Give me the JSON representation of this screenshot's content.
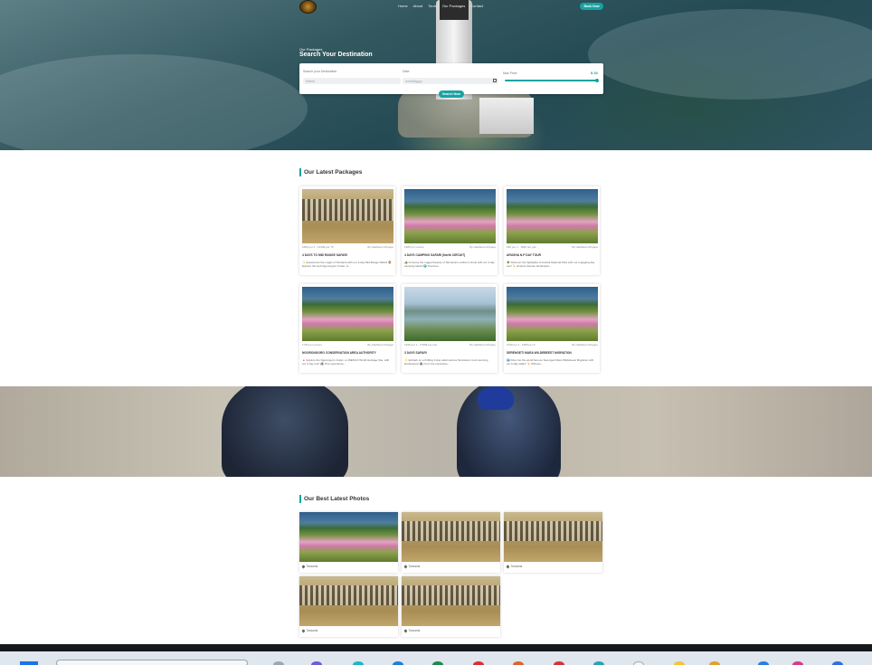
{
  "nav": {
    "items": [
      "Home",
      "About",
      "Tours",
      "Our Packages",
      "Contact"
    ],
    "book_now": "Book Now"
  },
  "search": {
    "eyebrow": "Our Packages",
    "title": "Search Your Destination",
    "destination_label": "Search your Destination",
    "destination_placeholder": "Select",
    "date_label": "Date",
    "date_placeholder": "mm/dd/yyyy",
    "price_label": "Max Price",
    "price_value": "$ 33",
    "price_level": 1.0,
    "button": "Search Now"
  },
  "packages": {
    "title": "Our Latest Packages",
    "items": [
      {
        "price": "1800 per 1 - 1640$ per 70",
        "author": "By Haidhuan Mnyape",
        "title": "4 DAYS TO MID RANGE SAFARI",
        "desc": "✨ Experience the magic of Tanzania with our 4-day Mid-Range Safari! 🦁 Explore the lush Ngorongoro Crater, w...",
        "image": "zebra"
      },
      {
        "price": "1980 per person",
        "author": "By Haidhuan Mnyape",
        "title": "4 DAYS CAMPING SAFARI (North CIRCUIT)",
        "desc": "🏕️ Immerse the rugged beauty of Tanzania's northern circuit with our 4-day camping safari! 🌍 Traverse...",
        "image": "flamingo"
      },
      {
        "price": "290 per 1 - 1890 per pax",
        "author": "By Haidhuan Mnyape",
        "title": "ARUSHA N.P DAY TOUR",
        "desc": "🌳 Discover the highlights of Arusha National Park with our engaging day tour! 🦒 Explore diverse landscapin...",
        "image": "flamingo"
      },
      {
        "price": "1700 per person",
        "author": "By Haidhuan Mnyape",
        "title": "NGORONGORO CONSERVATION AREA AUTHORITY",
        "desc": "🔺 Explore the Ngorongoro Crater, a UNESCO World Heritage Site, with our 2 day tour! 🦓 This experience...",
        "image": "flamingo"
      },
      {
        "price": "1290 per 1 - 1780$ per pax",
        "author": "By Haidhuan Mnyape",
        "title": "3 DAYS SAFARI",
        "desc": "✨ Embark on a thrilling 3-day safari across Tanzania's most stunning landscapes! 🦓 From the expansive...",
        "image": "lake"
      },
      {
        "price": "2790 per 1 - 1890 per 9",
        "author": "By Haidhuan Mnyape",
        "title": "SERENGETI MARA WILDEBEEST MIGRATION",
        "desc": "🌍 Dive into the world famous Serengeti Mara Wildebeest Migration with our 6-day safari! 🦒 Witness...",
        "image": "flamingo"
      }
    ]
  },
  "photos": {
    "title": "Our Best Latest Photos",
    "items": [
      {
        "caption": "Tanzania",
        "image": "flamingo"
      },
      {
        "caption": "Tanzania",
        "image": "zebra"
      },
      {
        "caption": "Tanzania",
        "image": "zebra"
      },
      {
        "caption": "Tanzania",
        "image": "zebra"
      },
      {
        "caption": "Tanzania",
        "image": "zebra"
      }
    ]
  },
  "colors": {
    "accent": "#17a3a3",
    "footer": "#15181c"
  }
}
